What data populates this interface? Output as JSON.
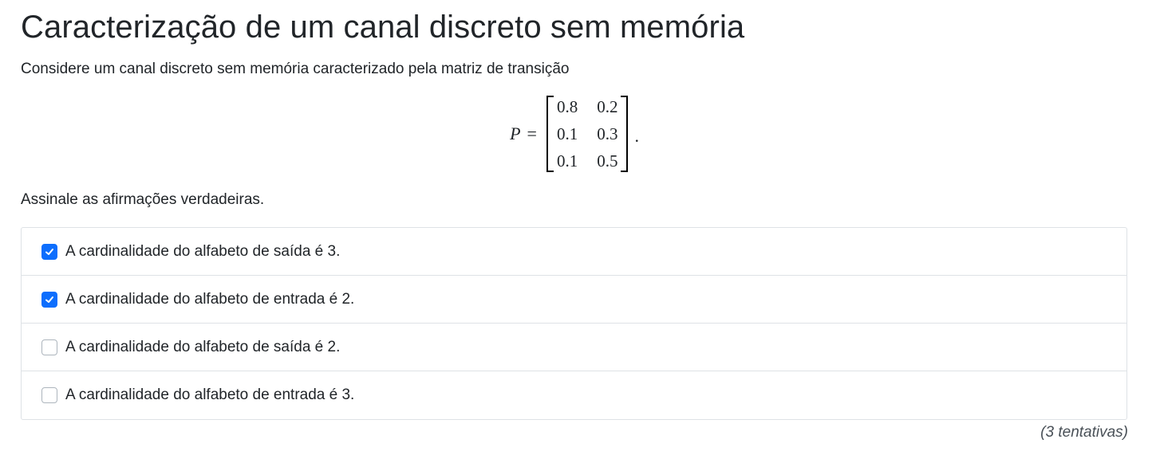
{
  "title": "Caracterização de um canal discreto sem memória",
  "intro": "Considere um canal discreto sem memória caracterizado pela matriz de transição",
  "matrix": {
    "variable": "P",
    "equals": "=",
    "rows": [
      [
        "0.8",
        "0.2"
      ],
      [
        "0.1",
        "0.3"
      ],
      [
        "0.1",
        "0.5"
      ]
    ],
    "trailing": "."
  },
  "prompt": "Assinale as afirmações verdadeiras.",
  "options": [
    {
      "label": "A cardinalidade do alfabeto de saída é 3.",
      "checked": true
    },
    {
      "label": "A cardinalidade do alfabeto de entrada é 2.",
      "checked": true
    },
    {
      "label": "A cardinalidade do alfabeto de saída é 2.",
      "checked": false
    },
    {
      "label": "A cardinalidade do alfabeto de entrada é 3.",
      "checked": false
    }
  ],
  "attempts": "(3 tentativas)",
  "colors": {
    "accent": "#0d6efd",
    "border": "#dee2e6"
  },
  "icons": {
    "check": "check-icon"
  }
}
